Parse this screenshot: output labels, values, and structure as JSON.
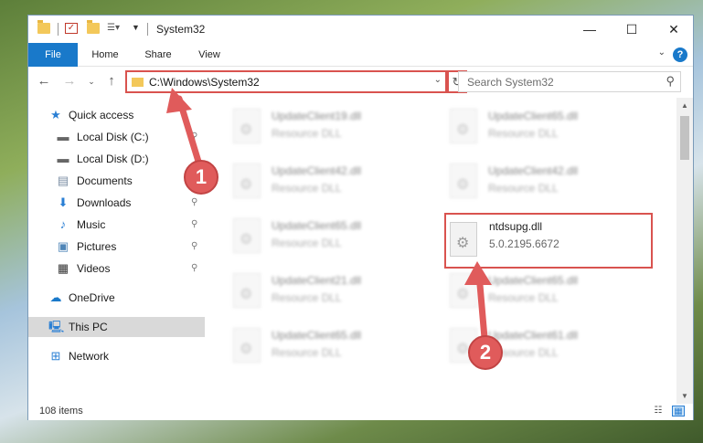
{
  "window": {
    "title": "System32"
  },
  "ribbon": {
    "tabs": [
      "File",
      "Home",
      "Share",
      "View"
    ],
    "help": "?"
  },
  "nav": {
    "address_path": "C:\\Windows\\System32",
    "search_placeholder": "Search System32"
  },
  "sidebar": {
    "items": [
      {
        "label": "Quick access",
        "icon": "star-icon"
      },
      {
        "label": "Local Disk (C:)",
        "icon": "drive-icon"
      },
      {
        "label": "Local Disk (D:)",
        "icon": "drive-icon"
      },
      {
        "label": "Documents",
        "icon": "documents-icon"
      },
      {
        "label": "Downloads",
        "icon": "download-icon"
      },
      {
        "label": "Music",
        "icon": "music-icon"
      },
      {
        "label": "Pictures",
        "icon": "pictures-icon"
      },
      {
        "label": "Videos",
        "icon": "videos-icon"
      },
      {
        "label": "OneDrive",
        "icon": "cloud-icon"
      },
      {
        "label": "This PC",
        "icon": "computer-icon"
      },
      {
        "label": "Network",
        "icon": "network-icon"
      }
    ]
  },
  "files": [
    {
      "name": "UpdateClient19.dll",
      "sub": "Resource DLL"
    },
    {
      "name": "UpdateClient65.dll",
      "sub": "Resource DLL"
    },
    {
      "name": "UpdateClient42.dll",
      "sub": "Resource DLL"
    },
    {
      "name": "UpdateClient42.dll",
      "sub": "Resource DLL"
    },
    {
      "name": "UpdateClient65.dll",
      "sub": "Resource DLL"
    },
    {
      "name": "ntdsupg.dll",
      "sub": "5.0.2195.6672"
    },
    {
      "name": "UpdateClient21.dll",
      "sub": "Resource DLL"
    },
    {
      "name": "UpdateClient65.dll",
      "sub": "Resource DLL"
    },
    {
      "name": "UpdateClient65.dll",
      "sub": "Resource DLL"
    },
    {
      "name": "UpdateClient61.dll",
      "sub": "Resource DLL"
    }
  ],
  "status": {
    "count": "108 items"
  },
  "annotations": {
    "step1": "1",
    "step2": "2"
  },
  "colors": {
    "accent": "#1979ca",
    "highlight": "#d9534f",
    "selected": "#d9d9d9"
  }
}
